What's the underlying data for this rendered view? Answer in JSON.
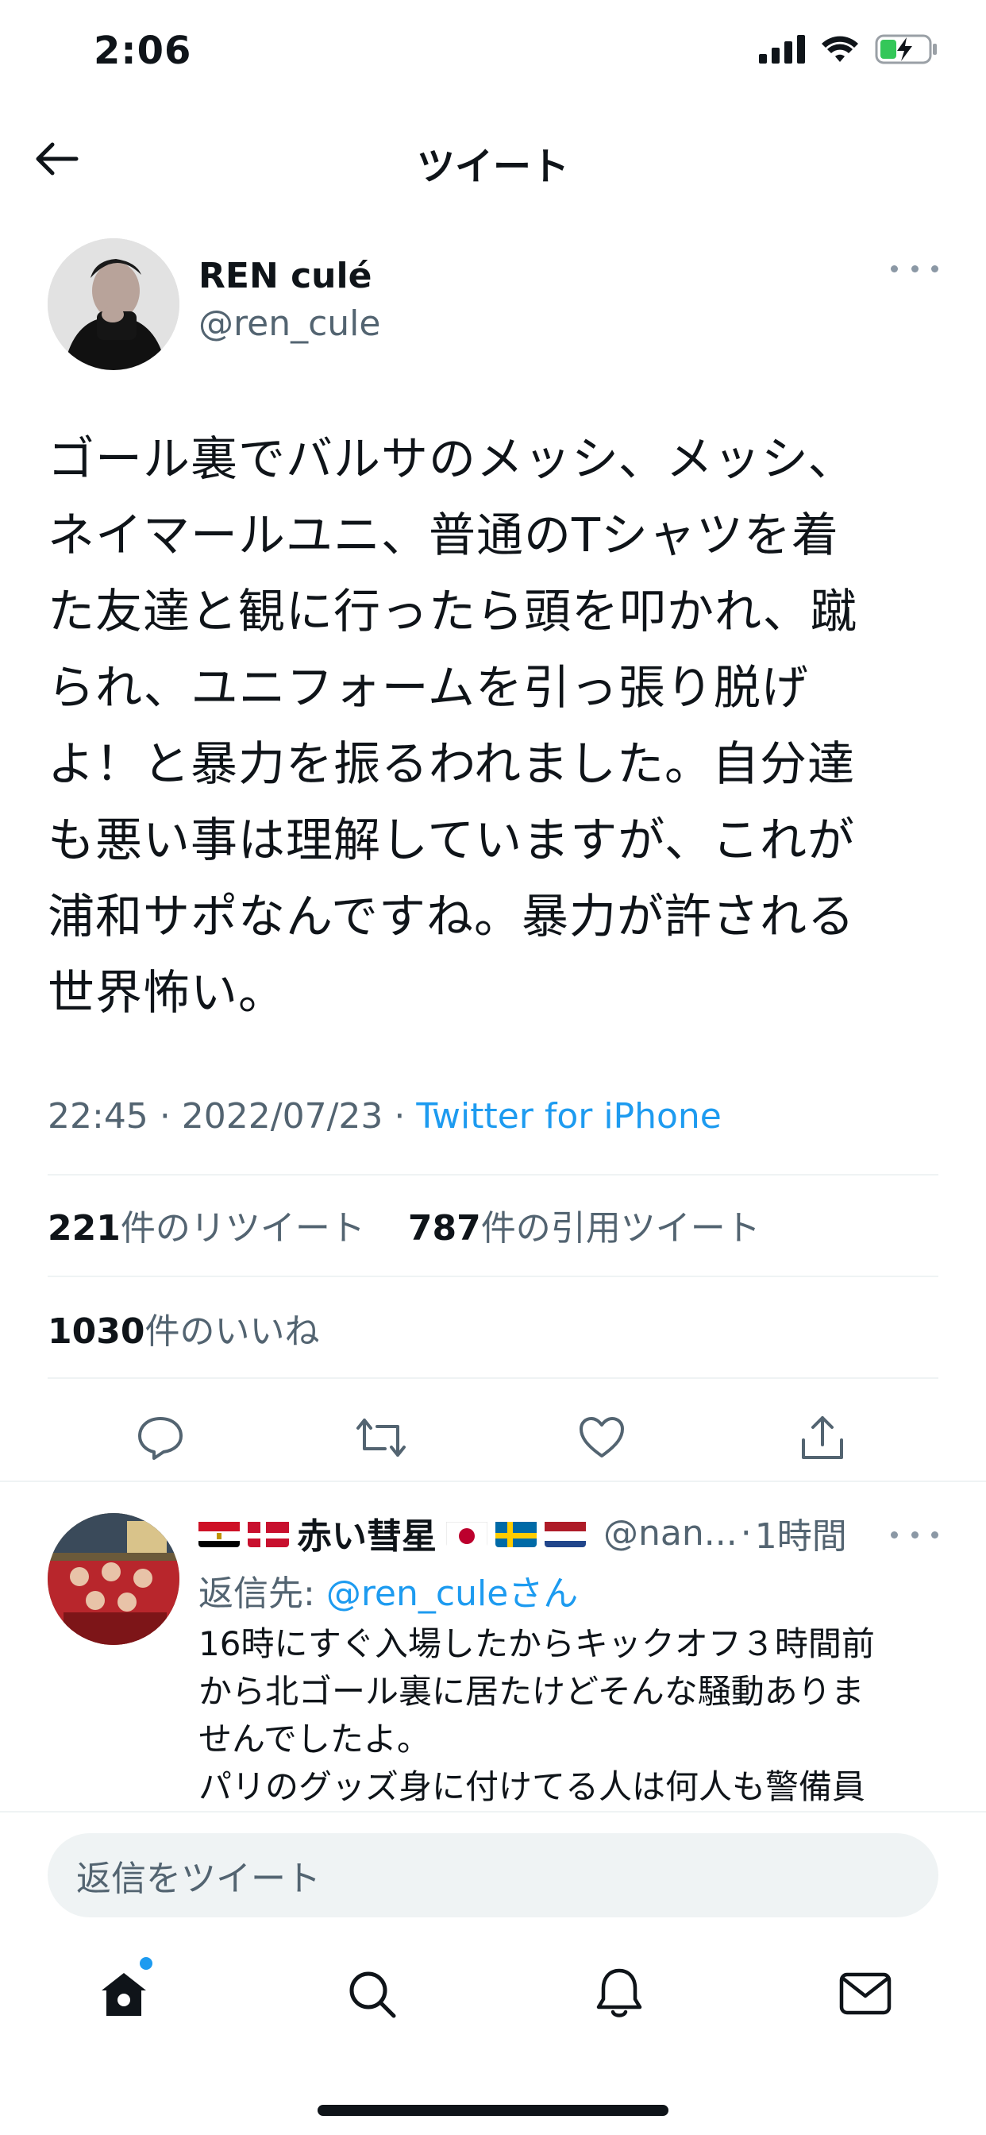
{
  "status_bar": {
    "time": "2:06"
  },
  "header": {
    "title": "ツイート"
  },
  "tweet": {
    "author_name": "REN culé",
    "author_handle": "@ren_cule",
    "text_lines": [
      "ゴール裏でバルサのメッシ、メッシ、",
      "ネイマールユニ、普通のTシャツを着",
      "た友達と観に行ったら頭を叩かれ、蹴",
      "られ、ユニフォームを引っ張り脱げ",
      "よ！と暴力を振るわれました。自分達",
      "も悪い事は理解していますが、これが",
      "浦和サポなんですね。暴力が許される",
      "世界怖い。"
    ],
    "time": "22:45",
    "date": "2022/07/23",
    "source": "Twitter for iPhone",
    "retweets_count": "221",
    "retweets_label": "件のリツイート",
    "quotes_count": "787",
    "quotes_label": "件の引用ツイート",
    "likes_count": "1030",
    "likes_label": "件のいいね"
  },
  "actions": {
    "reply_icon": "reply-icon",
    "retweet_icon": "retweet-icon",
    "like_icon": "heart-icon",
    "share_icon": "share-icon"
  },
  "reply": {
    "name": "赤い彗星",
    "handle": "@nan...",
    "time": "1時間",
    "reply_to_prefix": "返信先: ",
    "reply_to_mention": "@ren_cule",
    "reply_to_suffix": "さん",
    "text_lines": [
      "16時にすぐ入場したからキックオフ３時間前",
      "から北ゴール裏に居たけどそんな騒動ありま",
      "せんでしたよ。",
      "パリのグッズ身に付けてる人は何人も警備員"
    ]
  },
  "compose": {
    "placeholder": "返信をツイート"
  },
  "tabs": {
    "home": "home-icon",
    "search": "search-icon",
    "notifications": "bell-icon",
    "messages": "mail-icon"
  },
  "colors": {
    "accent": "#1d9bf0",
    "text": "#0f1419",
    "secondary": "#536471",
    "divider": "#eff3f4"
  }
}
